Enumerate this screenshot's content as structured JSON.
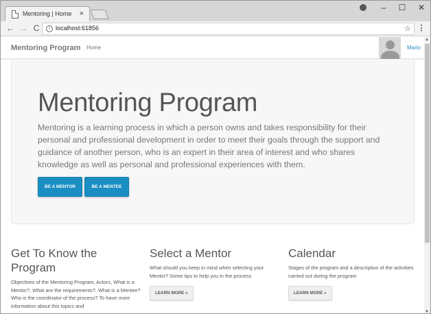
{
  "browser": {
    "tab_title": "Mentoring | Home",
    "tab_close": "×",
    "url": "localhost:61856",
    "window_buttons": {
      "minimize": "–",
      "maximize": "☐",
      "close": "✕"
    },
    "icons": {
      "back": "←",
      "forward": "→",
      "reload": "C",
      "info": "i",
      "star": "☆",
      "menu": "⋮"
    }
  },
  "navbar": {
    "brand": "Mentoring Program",
    "home_link": "Home",
    "user_name": "Mario"
  },
  "hero": {
    "title": "Mentoring Program",
    "text": "Mentoring is a learning process in which a person owns and takes responsibility for their personal and professional development in order to meet their goals through the support and guidance of another person, who is an expert in their area of interest and who shares knowledge as well as personal and professional experiences with them.",
    "btn_mentor": "BE A MENTOR",
    "btn_mentee": "BE A MENTEE"
  },
  "columns": [
    {
      "title": "Get To Know the Program",
      "text": "Objectives of the Mentoring Program, Actors, What is a Mentor?, What are the requirements?, What is a Mentee? Who is the coordinator of the process? To have more information about this topics and"
    },
    {
      "title": "Select a Mentor",
      "text": "What should you keep in mind when selecting your Mentor? Some tips to help you in the process",
      "button": "LEARN MORE »"
    },
    {
      "title": "Calendar",
      "text": "Stages of the program and a description of the activities carried out during the program",
      "button": "LEARN MORE »"
    }
  ],
  "colors": {
    "primary_button": "#1a8ec2",
    "user_link": "#2a8fc4",
    "jumbotron_bg": "#f7f7f7"
  }
}
